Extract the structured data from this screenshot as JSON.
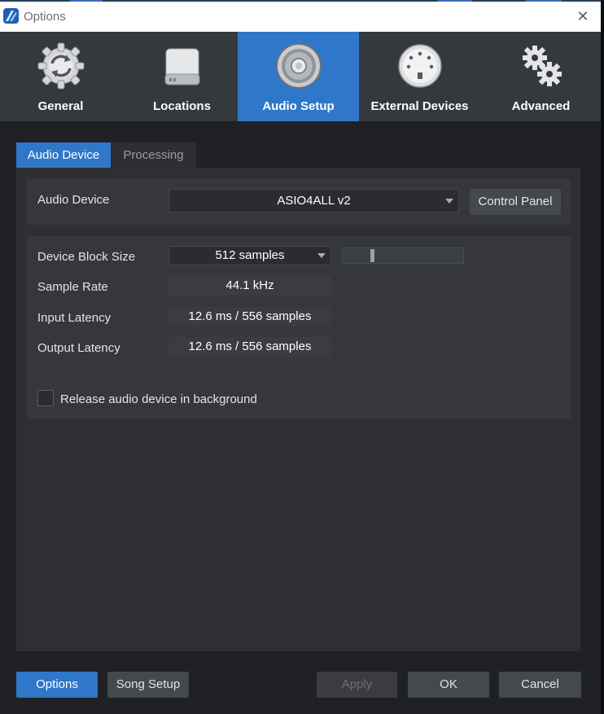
{
  "window": {
    "title": "Options",
    "close_glyph": "✕"
  },
  "nav": [
    {
      "label": "General",
      "icon": "general-refresh-gear-icon",
      "active": false
    },
    {
      "label": "Locations",
      "icon": "hard-drive-icon",
      "active": false
    },
    {
      "label": "Audio Setup",
      "icon": "speaker-icon",
      "active": true
    },
    {
      "label": "External Devices",
      "icon": "midi-connector-icon",
      "active": false
    },
    {
      "label": "Advanced",
      "icon": "gears-icon",
      "active": false
    }
  ],
  "subtabs": [
    {
      "label": "Audio Device",
      "active": true
    },
    {
      "label": "Processing",
      "active": false
    }
  ],
  "audio_device": {
    "label": "Audio Device",
    "value": "ASIO4ALL v2",
    "control_panel_label": "Control Panel"
  },
  "settings": {
    "block_size_label": "Device Block Size",
    "block_size_value": "512 samples",
    "block_size_slider_fraction": 0.24,
    "sample_rate_label": "Sample Rate",
    "sample_rate_value": "44.1 kHz",
    "input_latency_label": "Input Latency",
    "input_latency_value": "12.6 ms / 556 samples",
    "output_latency_label": "Output Latency",
    "output_latency_value": "12.6 ms / 556 samples",
    "release_label": "Release audio device in background",
    "release_checked": false
  },
  "footer": {
    "options_label": "Options",
    "song_setup_label": "Song Setup",
    "apply_label": "Apply",
    "ok_label": "OK",
    "cancel_label": "Cancel"
  },
  "colors": {
    "accent": "#2f77c8",
    "background": "#1f2124",
    "panel": "#2d2f33"
  }
}
